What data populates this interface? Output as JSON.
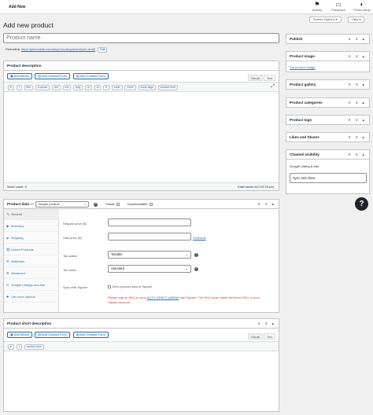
{
  "topbar": {
    "title": "Add New",
    "icons": [
      {
        "icon": "flag-icon",
        "label": "Activity"
      },
      {
        "icon": "feedback-icon",
        "label": "Feedback"
      },
      {
        "icon": "progress-icon",
        "label": "Finish setup"
      }
    ]
  },
  "screen_options": "Screen Options ▾",
  "help": "Help ▾",
  "page_title": "Add new product",
  "product_name": {
    "placeholder": "Product name"
  },
  "permalink": {
    "label": "Permalink:",
    "url": "https://juevonsite.com/shop/uncategorized/auto-draft/",
    "edit": "Edit"
  },
  "description": {
    "title": "Product description",
    "buttons": [
      "Add Media",
      "Add Contact Form",
      "Add Contact Form"
    ],
    "tabs": [
      "Visual",
      "Text"
    ],
    "quicktags": [
      "b",
      "i",
      "link",
      "b-quote",
      "del",
      "ins",
      "img",
      "ul",
      "ol",
      "li",
      "code",
      "more",
      "close tags",
      "contact form"
    ],
    "word_count": "Word count: 0",
    "draft_saved": "Draft saved at 1:04:15 pm."
  },
  "product_data": {
    "label": "Product data —",
    "type_select": "Simple product",
    "virtual": "Virtual:",
    "downloadable": "Downloadable:",
    "tabs": [
      {
        "icon": "wrench-icon",
        "glyph": "🔧",
        "label": "General"
      },
      {
        "icon": "inventory-icon",
        "glyph": "◆",
        "label": "Inventory"
      },
      {
        "icon": "truck-icon",
        "glyph": "▰",
        "label": "Shipping"
      },
      {
        "icon": "link-icon",
        "glyph": "⛓",
        "label": "Linked Products"
      },
      {
        "icon": "list-icon",
        "glyph": "☰",
        "label": "Attributes"
      },
      {
        "icon": "gear-icon",
        "glyph": "⚙",
        "label": "Advanced"
      },
      {
        "icon": "google-icon",
        "glyph": "G",
        "label": "Google Listings and Ads"
      },
      {
        "icon": "plug-icon",
        "glyph": "✚",
        "label": "Get more options"
      }
    ],
    "regular_price_label": "Regular price ($)",
    "sale_price_label": "Sale price ($)",
    "schedule": "Schedule",
    "tax_status_label": "Tax status",
    "tax_status_value": "Taxable",
    "tax_class_label": "Tax class",
    "tax_class_value": "Standard",
    "sync_label": "Sync with Square",
    "sync_checkbox": "Send product data to Square",
    "square_notice_pre": "Please add an SKU to sync",
    "square_notice_link": "AUTO-DRAFT (#5856)",
    "square_notice_post": "with Square. The SKU must match the item's SKU in your Square account."
  },
  "short_description": {
    "title": "Product short description",
    "buttons": [
      "Add Media",
      "Add Contact Form",
      "Add Contact Form"
    ],
    "tabs": [
      "Visual",
      "Text"
    ],
    "quicktags": [
      "b",
      "i",
      "contact form"
    ]
  },
  "sidebar": {
    "publish": "Publish",
    "product_image": "Product image",
    "set_product_image": "Set product image",
    "product_gallery": "Product gallery",
    "product_categories": "Product categories",
    "product_tags": "Product tags",
    "likes_shares": "Likes and Shares",
    "channel_visibility": "Channel visibility",
    "channel_name": "Google Listing & Ads",
    "channel_value": "Sync and show"
  },
  "arrows": "∧ ∨ ▴"
}
